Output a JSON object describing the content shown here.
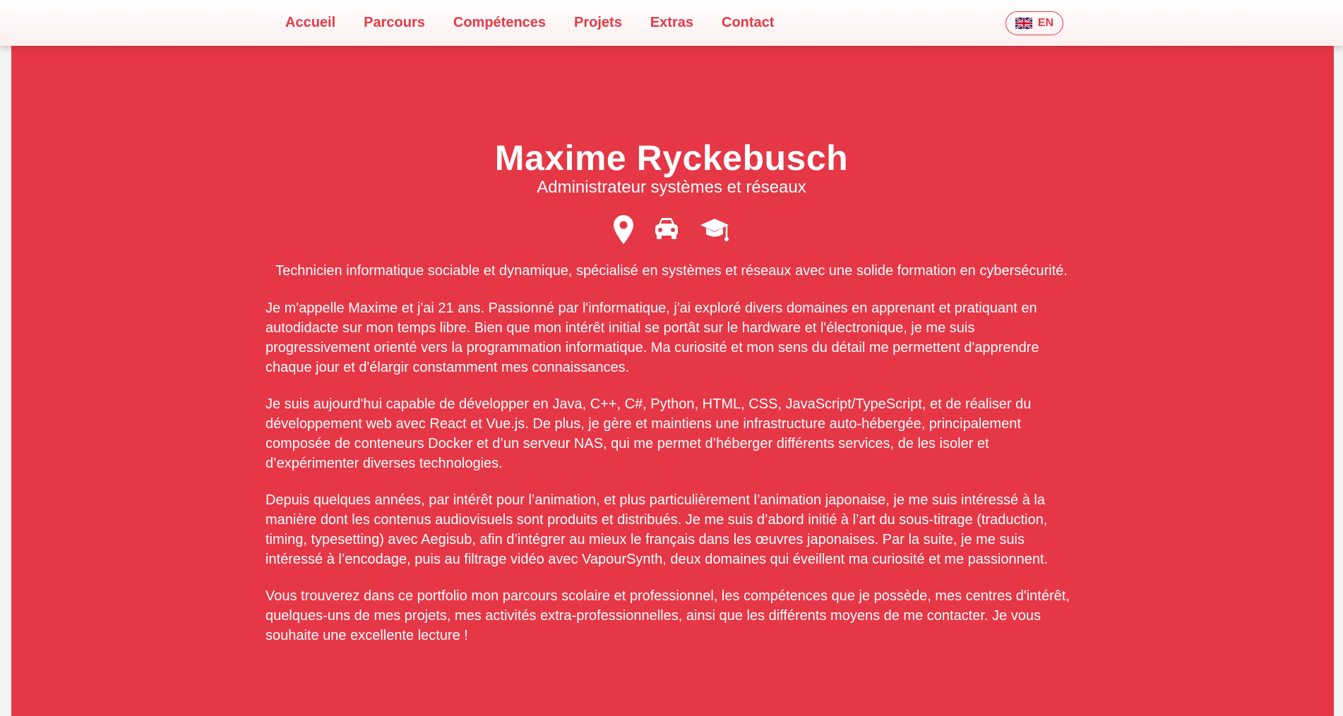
{
  "nav": {
    "links": [
      "Accueil",
      "Parcours",
      "Compétences",
      "Projets",
      "Extras",
      "Contact"
    ],
    "lang_label": "EN",
    "lang_icon": "uk-flag-icon"
  },
  "hero": {
    "name": "Maxime Ryckebusch",
    "subtitle": "Administrateur systèmes et réseaux",
    "icons": [
      "location-pin-icon",
      "car-icon",
      "graduation-cap-icon"
    ],
    "summary": "Technicien informatique sociable et dynamique, spécialisé en systèmes et réseaux avec une solide formation en cybersécurité."
  },
  "about": {
    "paragraphs": [
      "Je m'appelle Maxime et j'ai 21 ans. Passionné par l'informatique, j'ai exploré divers domaines en apprenant et pratiquant en autodidacte sur mon temps libre. Bien que mon intérêt initial se portât sur le hardware et l'électronique, je me suis progressivement orienté vers la programmation informatique. Ma curiosité et mon sens du détail me permettent d'apprendre chaque jour et d'élargir constamment mes connaissances.",
      "Je suis aujourd'hui capable de développer en Java, C++, C#, Python, HTML, CSS, JavaScript/TypeScript, et de réaliser du développement web avec React et Vue.js. De plus, je gère et maintiens une infrastructure auto-hébergée, principalement composée de conteneurs Docker et d’un serveur NAS, qui me permet d’héberger différents services, de les isoler et d’expérimenter diverses technologies.",
      "Depuis quelques années, par intérêt pour l’animation, et plus particulièrement l’animation japonaise, je me suis intéressé à la manière dont les contenus audiovisuels sont produits et distribués. Je me suis d’abord initié à l’art du sous-titrage (traduction, timing, typesetting) avec Aegisub, afin d’intégrer au mieux le français dans les œuvres japonaises. Par la suite, je me suis intéressé à l’encodage, puis au filtrage vidéo avec VapourSynth, deux domaines qui éveillent ma curiosité et me passionnent.",
      "Vous trouverez dans ce portfolio mon parcours scolaire et professionnel, les compétences que je possède, mes centres d'intérêt, quelques-uns de mes projets, mes activités extra-professionnelles, ainsi que les différents moyens de me contacter. Je vous souhaite une excellente lecture !"
    ]
  },
  "colors": {
    "accent": "#e63946",
    "background": "#e63746",
    "text_on_accent": "#ffffff"
  }
}
